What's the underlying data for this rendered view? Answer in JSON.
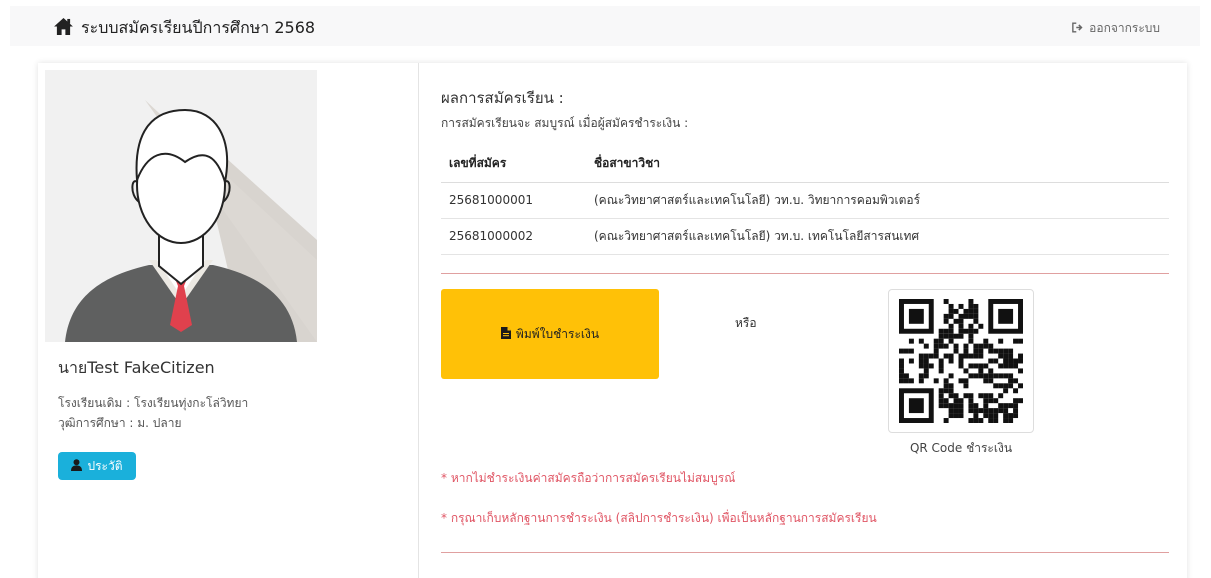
{
  "header": {
    "title": "ระบบสมัครเรียนปีการศึกษา 2568",
    "home_icon": "home-icon",
    "logout_label": "ออกจากระบบ",
    "logout_icon": "sign-out-icon"
  },
  "profile": {
    "name": "นายTest FakeCitizen",
    "school": "โรงเรียนเดิม : โรงเรียนทุ่งกะโล่วิทยา",
    "education": "วุฒิการศึกษา : ม. ปลาย",
    "history_button": "ประวัติ",
    "history_icon": "user-icon"
  },
  "result": {
    "heading": "ผลการสมัครเรียน :",
    "note": "การสมัครเรียนจะ สมบูรณ์ เมื่อผู้สมัครชำระเงิน :",
    "columns": [
      "เลขที่สมัคร",
      "ชื่อสาขาวิชา"
    ],
    "rows": [
      [
        "25681000001",
        "(คณะวิทยาศาสตร์และเทคโนโลยี) วท.บ. วิทยาการคอมพิวเตอร์"
      ],
      [
        "25681000002",
        "(คณะวิทยาศาสตร์และเทคโนโลยี) วท.บ. เทคโนโลยีสารสนเทศ"
      ]
    ]
  },
  "payment": {
    "print_button": "พิมพ์ใบชำระเงิน",
    "print_icon": "file-icon",
    "or_text": "หรือ",
    "qr_caption": "QR Code ชำระเงิน",
    "warning_1": "* หากไม่ชำระเงินค่าสมัครถือว่าการสมัครเรียนไม่สมบูรณ์",
    "warning_2": "* กรุณาเก็บหลักฐานการชำระเงิน (สลิปการชำระเงิน) เพื่อเป็นหลักฐานการสมัครเรียน"
  },
  "colors": {
    "accent_yellow": "#ffc107",
    "info_blue": "#1ab0db",
    "warning_red": "#e05564"
  }
}
